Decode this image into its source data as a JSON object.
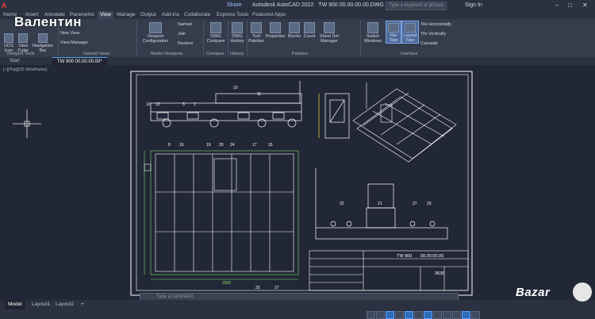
{
  "title_bar": {
    "app_title": "Autodesk AutoCAD 2022",
    "file_title": "TW 900 00.00.00.00.DWG",
    "share_label": "Share",
    "search_placeholder": "Type a keyword or phrase",
    "sign_in": "Sign In"
  },
  "overlay_text": "Валентин",
  "ribbon_tabs": [
    "Home",
    "Insert",
    "Annotate",
    "Parametric",
    "View",
    "Manage",
    "Output",
    "Add-ins",
    "Collaborate",
    "Express Tools",
    "Featured Apps"
  ],
  "active_tab": "View",
  "ribbon": {
    "viewport_tools": {
      "ucs_icon": "UCS Icon",
      "view_cube": "View Cube",
      "nav_bar": "Navigation Bar",
      "panel": "Viewport Tools"
    },
    "named_views": {
      "new_view": "New View",
      "view_manager": "View Manager",
      "panel": "Named Views"
    },
    "model_viewports": {
      "viewport_config": "Viewport Configuration",
      "named": "Named",
      "join": "Join",
      "restore": "Restore",
      "panel": "Model Viewports"
    },
    "compare": {
      "dwg_compare": "DWG Compare",
      "panel": "Compare"
    },
    "history": {
      "dwg_history": "DWG History",
      "panel": "History"
    },
    "palettes": {
      "tool_palettes": "Tool Palettes",
      "properties": "Properties",
      "blocks": "Blocks",
      "count": "Count",
      "sheet_set": "Sheet Set Manager",
      "panel": "Palettes"
    },
    "interface": {
      "switch_windows": "Switch Windows",
      "file_tabs": "File Tabs",
      "layout_tabs": "Layout Tabs",
      "tile_h": "Tile Horizontally",
      "tile_v": "Tile Vertically",
      "cascade": "Cascade",
      "panel": "Interface"
    }
  },
  "file_tabs": [
    "Start",
    "TW 900 00.00.00.00*"
  ],
  "viewport_label": "[–][Top][2D Wireframe]",
  "command_placeholder": "Type a command",
  "layout_tabs": [
    "Model",
    "Layout1",
    "Layout2"
  ],
  "drawing": {
    "callouts_top": [
      "10",
      "11",
      "12",
      "13",
      "3",
      "1",
      "5",
      "6"
    ],
    "callouts_plan": [
      "8",
      "16",
      "8",
      "19",
      "20",
      "24",
      "18",
      "5",
      "17",
      "15",
      "8"
    ],
    "callouts_bottom": [
      "22",
      "21",
      "27",
      "23",
      "25",
      "27"
    ],
    "dim_2000": "2000",
    "dim_3530": "3530",
    "title_block": "TW 900",
    "title_code": "00.00.00.00"
  },
  "watermark": "Bazar"
}
